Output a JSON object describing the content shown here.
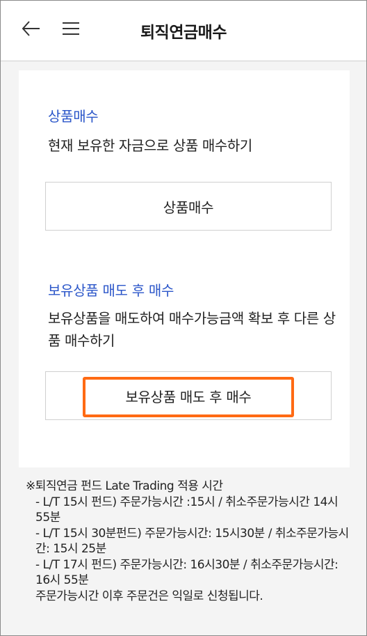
{
  "header": {
    "title": "퇴직연금매수",
    "back_icon": "back-arrow-icon",
    "menu_icon": "hamburger-menu-icon"
  },
  "buy_section": {
    "title": "상품매수",
    "description": "현재 보유한 자금으로 상품 매수하기",
    "button_label": "상품매수"
  },
  "sell_buy_section": {
    "title": "보유상품 매도 후 매수",
    "description": "보유상품을 매도하여 매수가능금액 확보 후 다른 상품 매수하기",
    "button_label": "보유상품 매도 후 매수"
  },
  "notice": {
    "heading": "※퇴직연금 펀드 Late Trading 적용 시간",
    "lines": [
      "- L/T 15시 펀드) 주문가능시간 :15시 / 취소주문가능시간 14시 55분",
      "- L/T 15시 30분펀드) 주문가능시간: 15시30분 / 취소주문가능시간: 15시 25분",
      "- L/T 17시 펀드) 주문가능시간: 16시30분 / 취소주문가능시간: 16시 55분",
      "주문가능시간 이후 주문건은 익일로 신청됩니다."
    ]
  },
  "colors": {
    "accent_blue": "#2b56c9",
    "highlight_orange": "#ff6a13",
    "background": "#f4f4f4"
  }
}
